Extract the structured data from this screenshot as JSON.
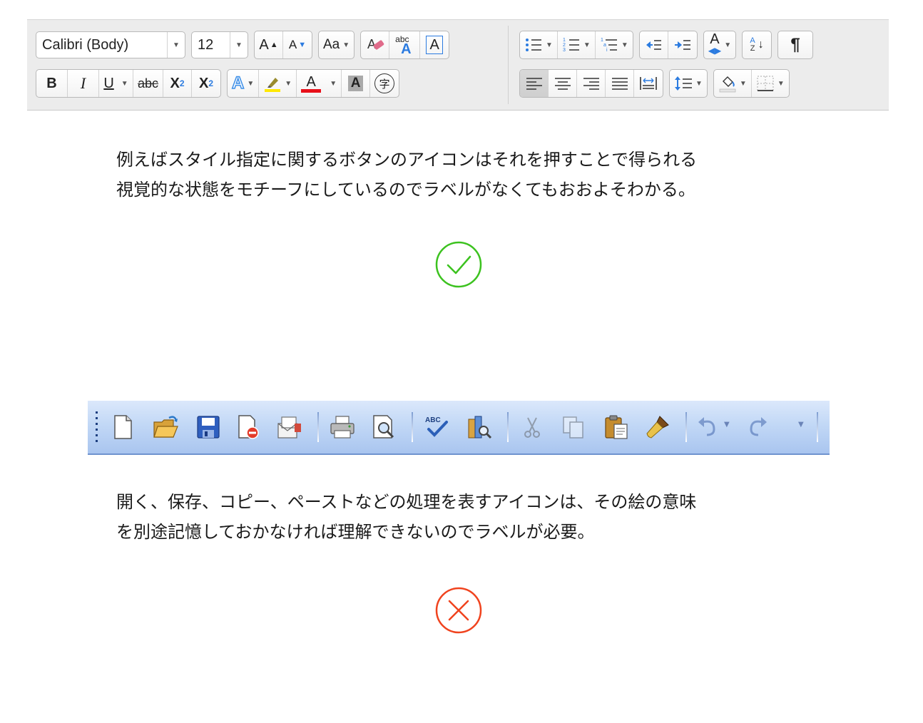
{
  "ribbon": {
    "font_name": "Calibri (Body)",
    "font_size": "12",
    "bold": "B",
    "italic": "I",
    "underline": "U",
    "strike": "abc",
    "subscript_base": "X",
    "subscript_mark": "2",
    "superscript_base": "X",
    "superscript_mark": "2",
    "grow_font": "A",
    "shrink_font": "A",
    "change_case": "Aa",
    "phonetic_small": "abc",
    "phonetic_big": "A",
    "char_border": "A",
    "text_effects": "A",
    "font_color": "A",
    "char_shading": "A",
    "enclose_char": "字",
    "style": "A",
    "sort_a": "A",
    "sort_z": "Z",
    "pilcrow": "¶",
    "colors": {
      "highlight": "#ffe800",
      "font_color": "#e8101a",
      "accent_blue": "#2b7be0",
      "text_effect": "#3d8fe8"
    }
  },
  "text": {
    "para1": [
      "例えばスタイル指定に関するボタンのアイコンはそれを押すことで得られる",
      "視覚的な状態をモチーフにしているのでラベルがなくてもおおよそわかる。"
    ],
    "para2": [
      "開く、保存、コピー、ペーストなどの処理を表すアイコンは、その絵の意味",
      "を別途記憶しておかなければ理解できないのでラベルが必要。"
    ]
  },
  "marks": {
    "ok_color": "#3cc21f",
    "ng_color": "#f0431e"
  },
  "classic_toolbar": {
    "spell_label": "ABC",
    "icons": [
      "new-document-icon",
      "open-folder-icon",
      "save-icon",
      "permission-icon",
      "email-icon",
      "print-icon",
      "print-preview-icon",
      "spelling-icon",
      "research-icon",
      "cut-icon",
      "copy-icon",
      "paste-icon",
      "format-painter-icon",
      "undo-icon",
      "redo-icon"
    ]
  }
}
